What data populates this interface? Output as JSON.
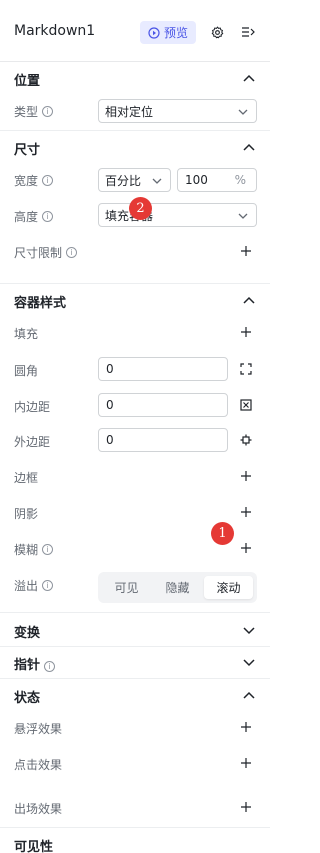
{
  "header": {
    "title": "Markdown1",
    "preview_label": "预览",
    "icons": [
      "play-circle-icon",
      "gear-icon",
      "collapse-panel-icon"
    ]
  },
  "sections": {
    "position": {
      "label": "位置"
    },
    "size": {
      "label": "尺寸"
    },
    "container_style": {
      "label": "容器样式"
    },
    "transform": {
      "label": "变换"
    },
    "pointer": {
      "label": "指针"
    },
    "state": {
      "label": "状态"
    },
    "visibility": {
      "label": "可见性"
    }
  },
  "position": {
    "type_label": "类型",
    "type_value": "相对定位"
  },
  "size": {
    "width_label": "宽度",
    "width_mode": "百分比",
    "width_value": "100",
    "width_unit": "%",
    "height_label": "高度",
    "height_value": "填充容器",
    "limit_label": "尺寸限制"
  },
  "container": {
    "fill_label": "填充",
    "radius_label": "圆角",
    "radius_value": "0",
    "padding_label": "内边距",
    "padding_value": "0",
    "margin_label": "外边距",
    "margin_value": "0",
    "border_label": "边框",
    "shadow_label": "阴影",
    "blur_label": "模糊",
    "overflow_label": "溢出",
    "overflow_options": [
      "可见",
      "隐藏",
      "滚动"
    ],
    "overflow_selected": "滚动"
  },
  "state": {
    "hover_label": "悬浮效果",
    "click_label": "点击效果",
    "enter_label": "出场效果"
  },
  "badges": {
    "one": "1",
    "two": "2"
  },
  "colors": {
    "accent": "#4a55e6",
    "accent_bg": "#e8ebff",
    "badge": "#e53935"
  }
}
